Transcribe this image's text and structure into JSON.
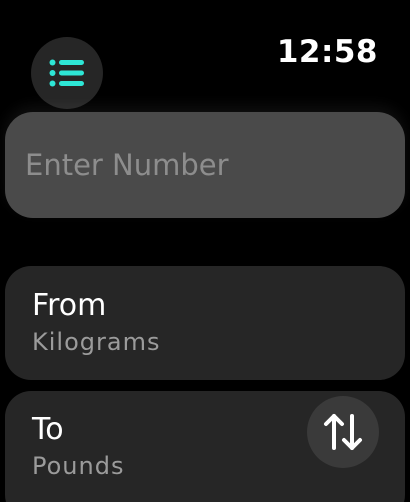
{
  "status_bar": {
    "time": "12:58"
  },
  "menu": {
    "icon": "list-icon",
    "color": "#2ee6d6"
  },
  "input": {
    "placeholder": "Enter Number",
    "value": ""
  },
  "from": {
    "title": "From",
    "unit": "Kilograms"
  },
  "to": {
    "title": "To",
    "unit": "Pounds"
  },
  "swap": {
    "icon": "swap-arrows-icon"
  }
}
